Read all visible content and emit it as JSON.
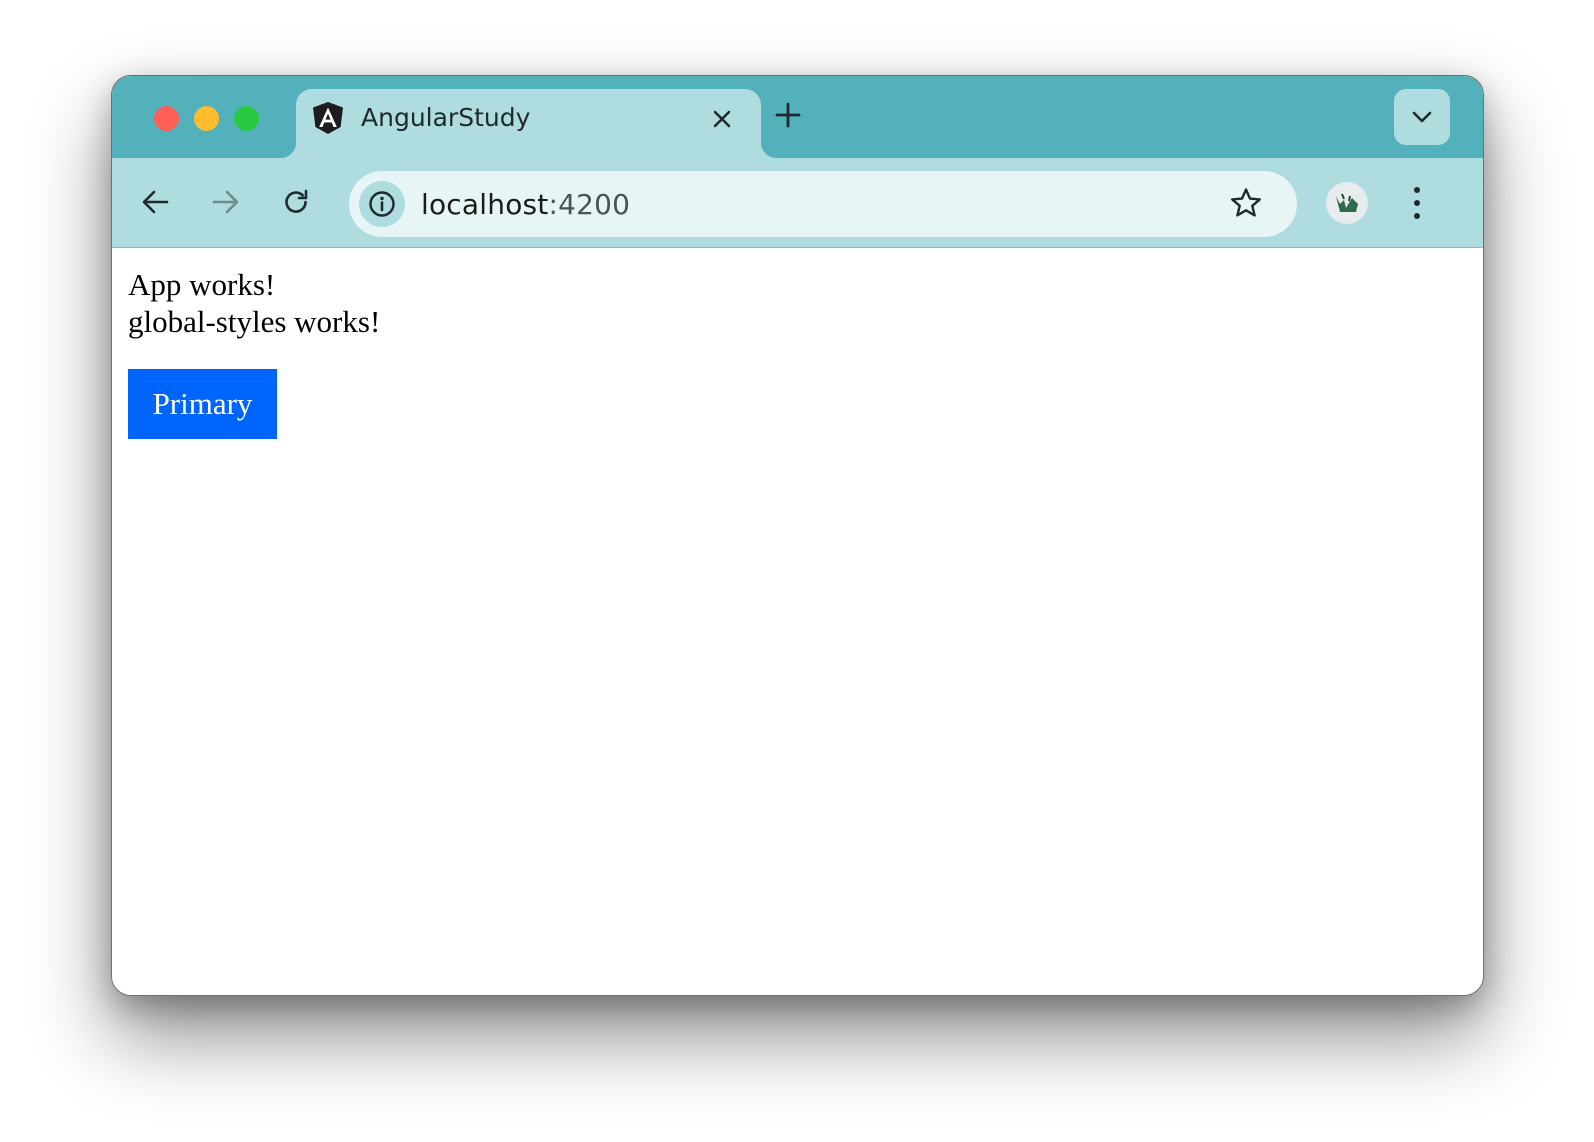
{
  "browser": {
    "tab": {
      "title": "AngularStudy",
      "favicon": "angular-logo-icon"
    },
    "address": {
      "host": "localhost",
      "port": ":4200"
    },
    "icons": {
      "back": "arrow-left-icon",
      "forward": "arrow-right-icon",
      "reload": "reload-icon",
      "site_info": "info-icon",
      "bookmark": "star-icon",
      "menu": "kebab-menu-icon",
      "tab_search": "chevron-down-icon",
      "new_tab": "plus-icon",
      "close_tab": "close-icon"
    },
    "colors": {
      "titlebar": "#52b1ba",
      "toolbar": "#aedcdf",
      "omnibox": "#e8f5f6"
    }
  },
  "page": {
    "line1": "App works!",
    "line2": "global-styles works!",
    "primary_button": "Primary",
    "primary_color": "#0065fd"
  }
}
